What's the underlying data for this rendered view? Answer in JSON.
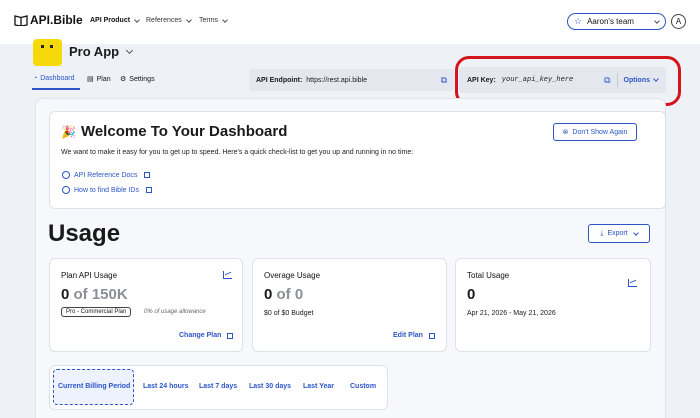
{
  "header": {
    "logo_text": "API.Bible",
    "nav": [
      {
        "label": "API Product"
      },
      {
        "label": "References"
      },
      {
        "label": "Terms"
      }
    ],
    "team_label": "Aaron's team",
    "avatar_initial": "A"
  },
  "app": {
    "title": "Pro App",
    "tabs": [
      {
        "label": "Dashboard"
      },
      {
        "label": "Plan"
      },
      {
        "label": "Settings"
      }
    ],
    "endpoint_label": "API Endpoint:",
    "endpoint_value": "https://rest.api.bible",
    "key_label": "API Key:",
    "key_value": "your_api_key_here",
    "options_label": "Options"
  },
  "welcome": {
    "title": "Welcome To Your Dashboard",
    "text": "We want to make it easy for you to get up to speed. Here's a quick check-list to get you up and running in no time:",
    "dismiss_label": "Don't Show Again",
    "checklist": [
      {
        "label": "API Reference Docs"
      },
      {
        "label": "How to find Bible IDs"
      }
    ]
  },
  "usage": {
    "heading": "Usage",
    "export_label": "Export",
    "cards": [
      {
        "title": "Plan API Usage",
        "value": "0",
        "of": "of 150K",
        "badge": "Pro - Commercial Plan",
        "note": "0% of usage allowance",
        "link": "Change Plan"
      },
      {
        "title": "Overage Usage",
        "value": "0",
        "of": "of 0",
        "budget": "$0 of $0 Budget",
        "link": "Edit Plan"
      },
      {
        "title": "Total Usage",
        "value": "0",
        "range": "Apr 21, 2026 - May 21, 2026"
      }
    ],
    "periods": [
      {
        "label": "Current Billing Period",
        "active": true
      },
      {
        "label": "Last 24 hours"
      },
      {
        "label": "Last 7 days"
      },
      {
        "label": "Last 30 days"
      },
      {
        "label": "Last Year"
      },
      {
        "label": "Custom"
      }
    ]
  },
  "colors": {
    "accent": "#2c55c7",
    "highlight_ring": "#d4141b",
    "app_icon": "#f5d90a"
  }
}
